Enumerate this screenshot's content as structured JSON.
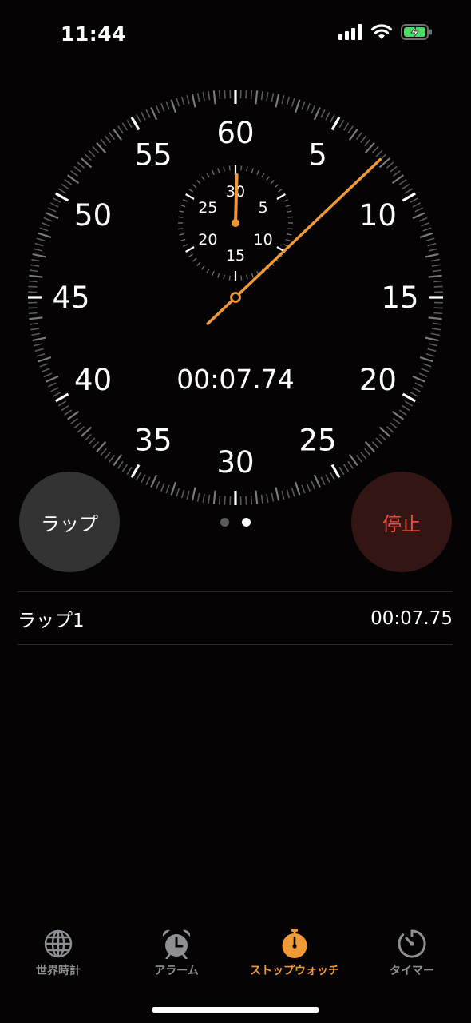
{
  "status_bar": {
    "time": "11:44",
    "icons": [
      "cellular-signal-icon",
      "wifi-icon",
      "battery-charging-icon"
    ]
  },
  "stopwatch": {
    "elapsed_display": "00:07.74",
    "elapsed_seconds": 7.74,
    "main_dial_labels": [
      "60",
      "5",
      "10",
      "15",
      "20",
      "25",
      "30",
      "35",
      "40",
      "45",
      "50",
      "55"
    ],
    "sub_dial_labels": [
      "30",
      "5",
      "10",
      "15",
      "20",
      "25"
    ],
    "hand_color": "#f09a37"
  },
  "buttons": {
    "lap_label": "ラップ",
    "stop_label": "停止"
  },
  "page_indicator": {
    "count": 2,
    "active_index": 1
  },
  "laps": [
    {
      "label": "ラップ1",
      "time": "00:07.75"
    }
  ],
  "tabs": [
    {
      "label": "世界時計",
      "icon": "globe-icon",
      "active": false
    },
    {
      "label": "アラーム",
      "icon": "alarm-clock-icon",
      "active": false
    },
    {
      "label": "ストップウォッチ",
      "icon": "stopwatch-icon",
      "active": true
    },
    {
      "label": "タイマー",
      "icon": "timer-icon",
      "active": false
    }
  ],
  "colors": {
    "accent": "#f09a37",
    "stop_text": "#eb4d3d",
    "stop_bg": "#331513",
    "lap_bg": "#333333",
    "inactive_tab": "#8e8e93"
  }
}
